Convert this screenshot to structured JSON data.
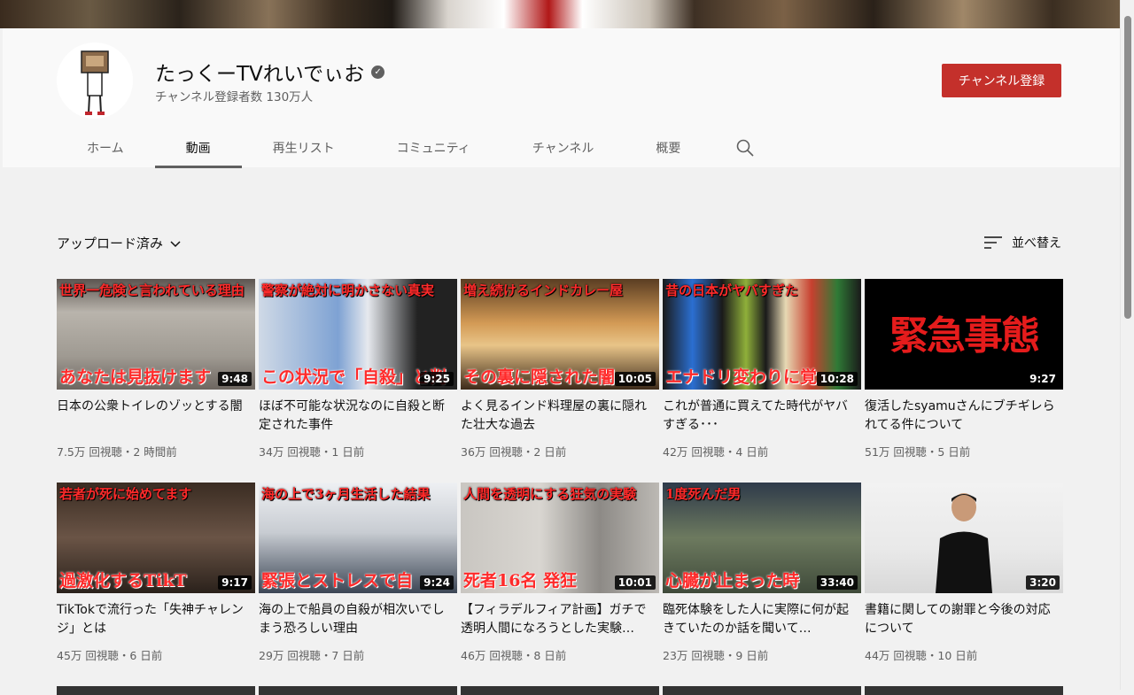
{
  "channel": {
    "name": "たっくーTVれいでぃお",
    "subscribers": "チャンネル登録者数 130万人",
    "subscribe_label": "チャンネル登録",
    "verified_icon": "check-circle-icon"
  },
  "tabs": [
    {
      "label": "ホーム",
      "active": false
    },
    {
      "label": "動画",
      "active": true
    },
    {
      "label": "再生リスト",
      "active": false
    },
    {
      "label": "コミュニティ",
      "active": false
    },
    {
      "label": "チャンネル",
      "active": false
    },
    {
      "label": "概要",
      "active": false
    }
  ],
  "filter": {
    "label": "アップロード済み"
  },
  "sort": {
    "label": "並べ替え"
  },
  "videos": [
    {
      "title": "日本の公衆トイレのゾッとする闇",
      "meta": "7.5万 回視聴・2 時間前",
      "duration": "9:48",
      "thumb_top": "世界一危険と言われている理由",
      "thumb_bottom": "あなたは見抜けます",
      "thumb_center": ""
    },
    {
      "title": "ほぼ不可能な状況なのに自殺と断定された事件",
      "meta": "34万 回視聴・1 日前",
      "duration": "9:25",
      "thumb_top": "警察が絶対に明かさない真実",
      "thumb_bottom": "この状況で「自殺」と判",
      "thumb_center": ""
    },
    {
      "title": "よく見るインド料理屋の裏に隠れた壮大な過去",
      "meta": "36万 回視聴・2 日前",
      "duration": "10:05",
      "thumb_top": "増え続けるインドカレー屋",
      "thumb_bottom": "その裏に隠された闇",
      "thumb_center": ""
    },
    {
      "title": "これが普通に買えてた時代がヤバすぎる･･･",
      "meta": "42万 回視聴・4 日前",
      "duration": "10:28",
      "thumb_top": "昔の日本がヤバすぎた",
      "thumb_bottom": "エナドリ変わりに覚",
      "thumb_center": ""
    },
    {
      "title": "復活したsyamuさんにブチギレられてる件について",
      "meta": "51万 回視聴・5 日前",
      "duration": "9:27",
      "thumb_top": "",
      "thumb_bottom": "",
      "thumb_center": "緊急事態"
    },
    {
      "title": "TikTokで流行った「失神チャレンジ」とは",
      "meta": "45万 回視聴・6 日前",
      "duration": "9:17",
      "thumb_top": "若者が死に始めてます",
      "thumb_bottom": "過激化するTikT",
      "thumb_center": ""
    },
    {
      "title": "海の上で船員の自殺が相次いでしまう恐ろしい理由",
      "meta": "29万 回視聴・7 日前",
      "duration": "9:24",
      "thumb_top": "海の上で3ヶ月生活した結果",
      "thumb_bottom": "緊張とストレスで自",
      "thumb_center": ""
    },
    {
      "title": "【フィラデルフィア計画】ガチで透明人間になろうとした実験…",
      "meta": "46万 回視聴・8 日前",
      "duration": "10:01",
      "thumb_top": "人間を透明にする狂気の実験",
      "thumb_bottom": "死者16名 発狂",
      "thumb_center": ""
    },
    {
      "title": "臨死体験をした人に実際に何が起きていたのか話を聞いて…",
      "meta": "23万 回視聴・9 日前",
      "duration": "33:40",
      "thumb_top": "1度死んだ男",
      "thumb_bottom": "心臓が止まった時",
      "thumb_center": ""
    },
    {
      "title": "書籍に関しての謝罪と今後の対応について",
      "meta": "44万 回視聴・10 日前",
      "duration": "3:20",
      "thumb_top": "",
      "thumb_bottom": "",
      "thumb_center": ""
    }
  ],
  "colors": {
    "subscribe": "#c4302b",
    "accent_red": "#e51c1c"
  }
}
